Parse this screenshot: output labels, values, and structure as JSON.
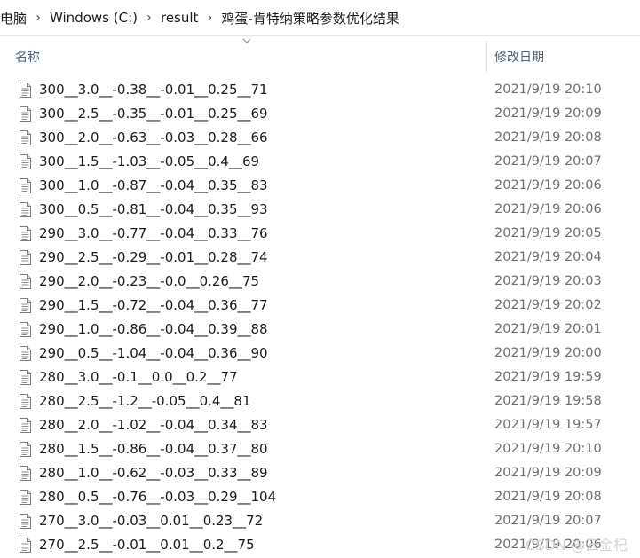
{
  "breadcrumb": {
    "items": [
      "电脑",
      "Windows (C:)",
      "result",
      "鸡蛋-肯特纳策略参数优化结果"
    ],
    "separator": "›"
  },
  "columns": {
    "name": "名称",
    "date": "修改日期"
  },
  "files": [
    {
      "name": "300__3.0__-0.38__-0.01__0.25__71",
      "date": "2021/9/19 20:10"
    },
    {
      "name": "300__2.5__-0.35__-0.01__0.25__69",
      "date": "2021/9/19 20:09"
    },
    {
      "name": "300__2.0__-0.63__-0.03__0.28__66",
      "date": "2021/9/19 20:08"
    },
    {
      "name": "300__1.5__-1.03__-0.05__0.4__69",
      "date": "2021/9/19 20:07"
    },
    {
      "name": "300__1.0__-0.87__-0.04__0.35__83",
      "date": "2021/9/19 20:06"
    },
    {
      "name": "300__0.5__-0.81__-0.04__0.35__93",
      "date": "2021/9/19 20:06"
    },
    {
      "name": "290__3.0__-0.77__-0.04__0.33__76",
      "date": "2021/9/19 20:05"
    },
    {
      "name": "290__2.5__-0.29__-0.01__0.28__74",
      "date": "2021/9/19 20:04"
    },
    {
      "name": "290__2.0__-0.23__-0.0__0.26__75",
      "date": "2021/9/19 20:03"
    },
    {
      "name": "290__1.5__-0.72__-0.04__0.36__77",
      "date": "2021/9/19 20:02"
    },
    {
      "name": "290__1.0__-0.86__-0.04__0.39__88",
      "date": "2021/9/19 20:01"
    },
    {
      "name": "290__0.5__-1.04__-0.04__0.36__90",
      "date": "2021/9/19 20:00"
    },
    {
      "name": "280__3.0__-0.1__0.0__0.2__77",
      "date": "2021/9/19 19:59"
    },
    {
      "name": "280__2.5__-1.2__-0.05__0.4__81",
      "date": "2021/9/19 19:58"
    },
    {
      "name": "280__2.0__-1.02__-0.04__0.34__83",
      "date": "2021/9/19 19:57"
    },
    {
      "name": "280__1.5__-0.86__-0.04__0.37__80",
      "date": "2021/9/19 20:10"
    },
    {
      "name": "280__1.0__-0.62__-0.03__0.33__89",
      "date": "2021/9/19 20:09"
    },
    {
      "name": "280__0.5__-0.76__-0.03__0.29__104",
      "date": "2021/9/19 20:08"
    },
    {
      "name": "270__3.0__-0.03__0.01__0.23__72",
      "date": "2021/9/19 20:07"
    },
    {
      "name": "270__2.5__-0.01__0.01__0.2__75",
      "date": "2021/9/19 20:06"
    }
  ],
  "watermark": "CSDN @云金杞",
  "icons": {
    "file": "text-file-icon",
    "separator": "chevron-right-icon",
    "sort": "sort-up-icon"
  },
  "colors": {
    "header_text": "#4c607a",
    "date_text": "#6f6f6f",
    "watermark": "#d4d4d4"
  }
}
